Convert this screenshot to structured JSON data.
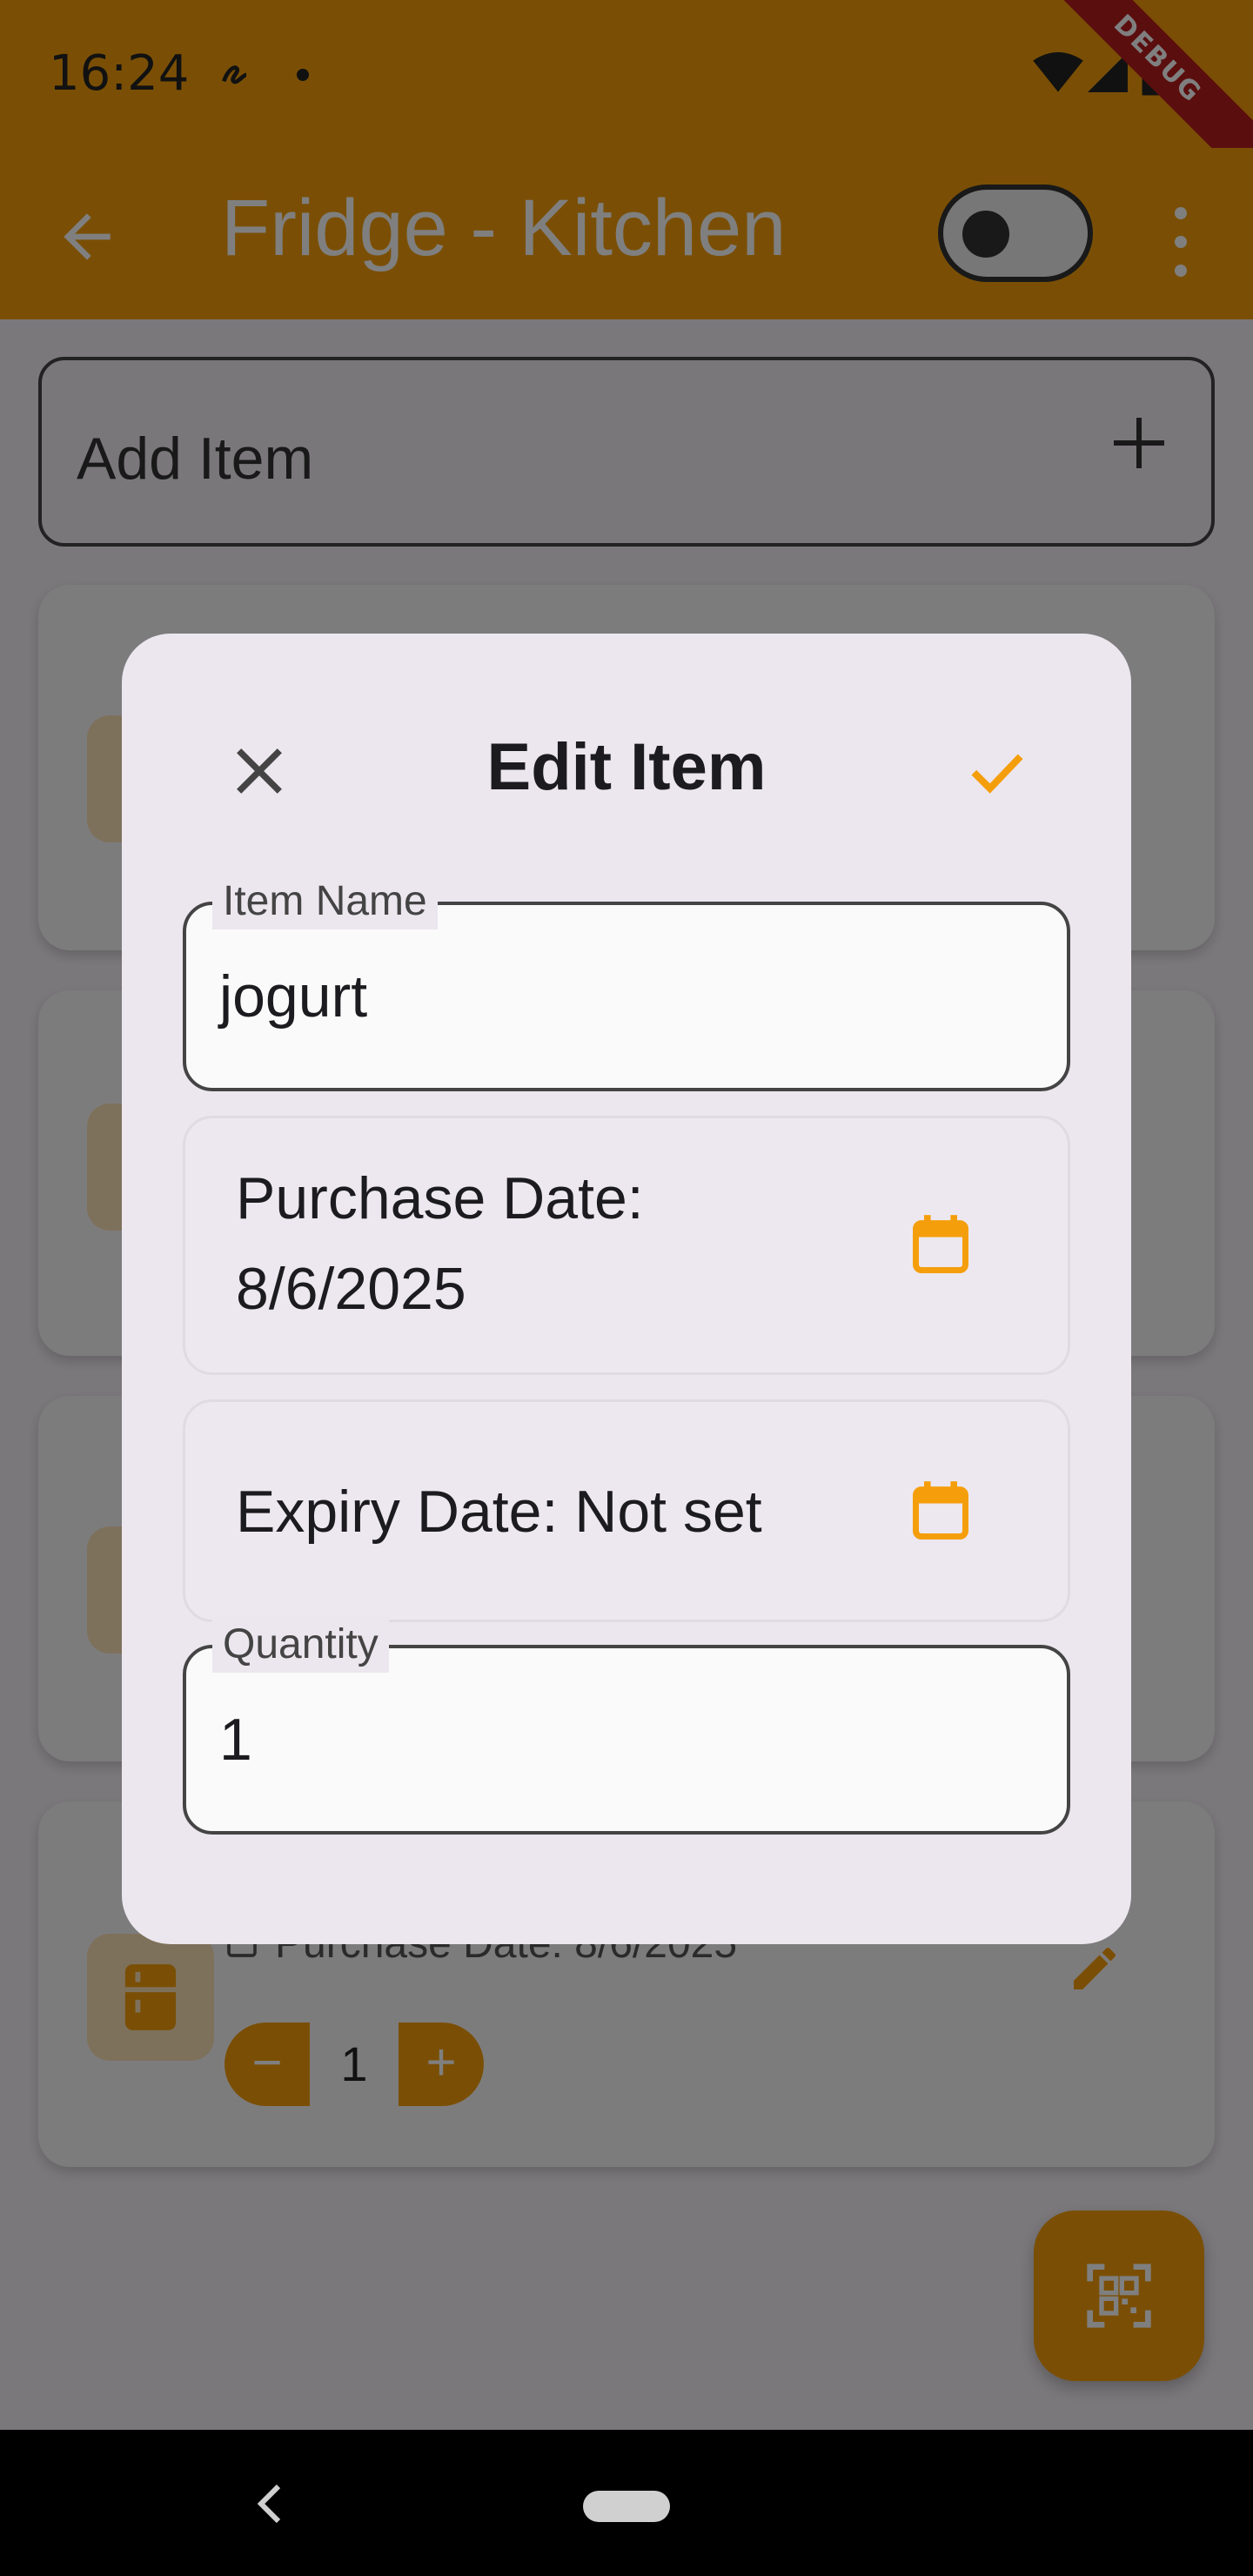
{
  "status_bar": {
    "time": "16:24",
    "debug_label": "DEBUG"
  },
  "app_bar": {
    "title": "Fridge - Kitchen"
  },
  "add_item": {
    "label": "Add Item"
  },
  "bottom_card": {
    "purchase_date": "Purchase Date: 8/6/2025",
    "quantity": "1",
    "minus": "−",
    "plus": "+"
  },
  "dialog": {
    "title": "Edit Item",
    "item_name_label": "Item Name",
    "item_name_value": "jogurt",
    "purchase_date_line1": "Purchase Date:",
    "purchase_date_line2": "8/6/2025",
    "expiry_date": "Expiry Date: Not set",
    "quantity_label": "Quantity",
    "quantity_value": "1"
  },
  "colors": {
    "accent": "#f59e0b",
    "dialog_bg": "#ece6ee",
    "text": "#1c1b1f"
  },
  "icons": [
    "back-arrow-icon",
    "toggle-switch",
    "more-vert-icon",
    "add-icon",
    "kitchen-icon",
    "calendar-icon",
    "edit-icon",
    "qr-scan-icon",
    "close-icon",
    "check-icon"
  ]
}
